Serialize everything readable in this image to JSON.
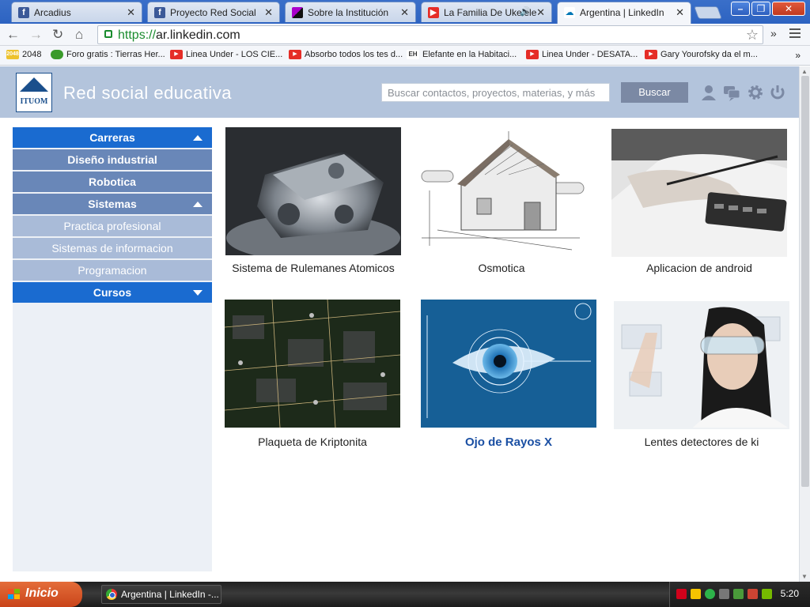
{
  "browser": {
    "tabs": [
      {
        "title": "Arcadius",
        "favicon": "facebook-icon",
        "active": false
      },
      {
        "title": "Proyecto Red Social",
        "favicon": "facebook-icon",
        "active": false
      },
      {
        "title": "Sobre la Institución",
        "favicon": "site-icon",
        "active": false
      },
      {
        "title": "La Familia De Ukelele",
        "favicon": "youtube-icon",
        "active": false,
        "audio": true
      },
      {
        "title": "Argentina | LinkedIn",
        "favicon": "linkedin-icon",
        "active": true
      }
    ],
    "url_scheme": "https://",
    "url_host": "ar.linkedin.com",
    "more_chevron": "»",
    "bookmarks": [
      {
        "label": "2048",
        "icon": "2048-icon"
      },
      {
        "label": "Foro gratis : Tierras Her...",
        "icon": "forum-icon"
      },
      {
        "label": "Linea Under - LOS CIE...",
        "icon": "youtube-icon"
      },
      {
        "label": "Absorbo todos los tes d...",
        "icon": "youtube-icon"
      },
      {
        "label": "Elefante en la Habitaci...",
        "icon": "eh-icon"
      },
      {
        "label": "Linea Under - DESATA...",
        "icon": "youtube-icon"
      },
      {
        "label": "Gary Yourofsky da el m...",
        "icon": "youtube-icon"
      }
    ],
    "bookmarks_more": "»"
  },
  "site": {
    "logo_text": "ITUOM",
    "title": "Red social educativa",
    "search_placeholder": "Buscar contactos, proyectos, materias, y más",
    "search_button": "Buscar"
  },
  "sidebar": {
    "items": [
      {
        "label": "Carreras",
        "level": "head",
        "arrow": "up"
      },
      {
        "label": "Diseño industrial",
        "level": "sub"
      },
      {
        "label": "Robotica",
        "level": "sub"
      },
      {
        "label": "Sistemas",
        "level": "sub",
        "arrow": "up"
      },
      {
        "label": "Practica profesional",
        "level": "leaf"
      },
      {
        "label": "Sistemas de informacion",
        "level": "leaf"
      },
      {
        "label": "Programacion",
        "level": "leaf"
      },
      {
        "label": "Cursos",
        "level": "head",
        "arrow": "down"
      }
    ]
  },
  "projects": [
    {
      "label": "Sistema de Rulemanes Atomicos",
      "image": "engine-image"
    },
    {
      "label": "Osmotica",
      "image": "house-blueprint-image"
    },
    {
      "label": "Aplicacion de android",
      "image": "calculator-hand-image"
    },
    {
      "label": "Plaqueta de Kriptonita",
      "image": "circuit-board-image"
    },
    {
      "label": "Ojo de Rayos X",
      "image": "eye-scan-image",
      "highlighted": true
    },
    {
      "label": "Lentes detectores de ki",
      "image": "woman-goggles-image"
    }
  ],
  "taskbar": {
    "start_label": "Inicio",
    "window_label": "Argentina | LinkedIn -...",
    "clock": "5:20"
  }
}
